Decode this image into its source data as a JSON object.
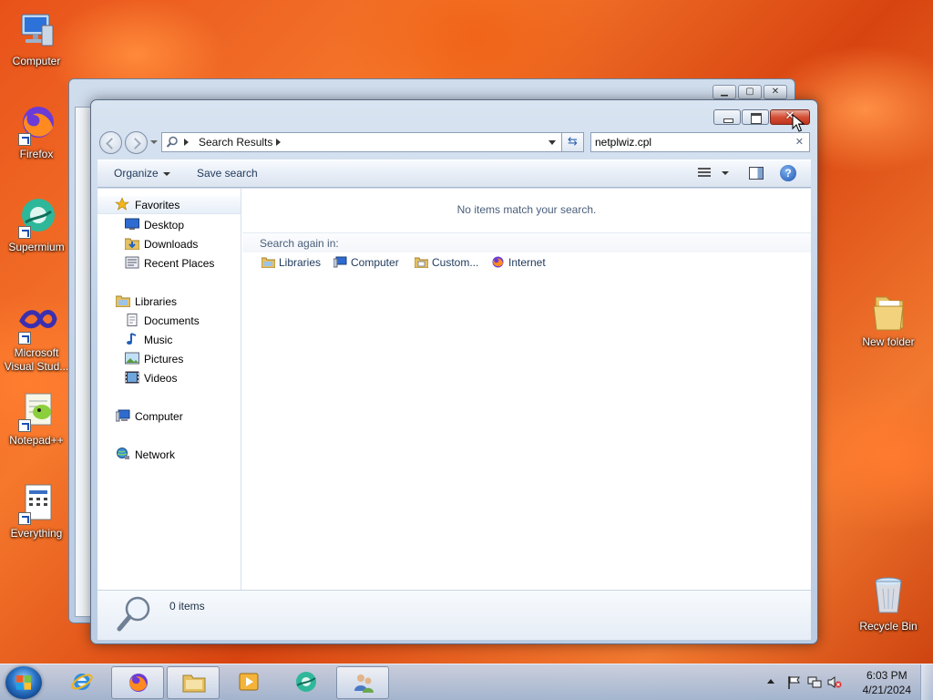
{
  "desktop": {
    "icons": [
      {
        "label": "Computer"
      },
      {
        "label": "Firefox"
      },
      {
        "label": "Supermium"
      },
      {
        "label": "Microsoft Visual Stud..."
      },
      {
        "label": "Notepad++"
      },
      {
        "label": "Everything"
      },
      {
        "label": "New folder"
      },
      {
        "label": "Recycle Bin"
      }
    ]
  },
  "explorer": {
    "address": {
      "crumb": "Search Results"
    },
    "search": {
      "value": "netplwiz.cpl"
    },
    "toolbar": {
      "organize": "Organize",
      "save_search": "Save search"
    },
    "nav": {
      "favorites": "Favorites",
      "desktop": "Desktop",
      "downloads": "Downloads",
      "recent": "Recent Places",
      "libraries": "Libraries",
      "documents": "Documents",
      "music": "Music",
      "pictures": "Pictures",
      "videos": "Videos",
      "computer": "Computer",
      "network": "Network"
    },
    "content": {
      "no_items": "No items match your search.",
      "search_again": "Search again in:",
      "locations": [
        "Libraries",
        "Computer",
        "Custom...",
        "Internet"
      ]
    },
    "details": {
      "count": "0 items"
    }
  },
  "taskbar": {
    "clock": {
      "time": "6:03 PM",
      "date": "4/21/2024"
    }
  },
  "colors": {
    "accent": "#1e395b",
    "close_red": "#c1331b",
    "taskbar": "#a9bedb"
  }
}
